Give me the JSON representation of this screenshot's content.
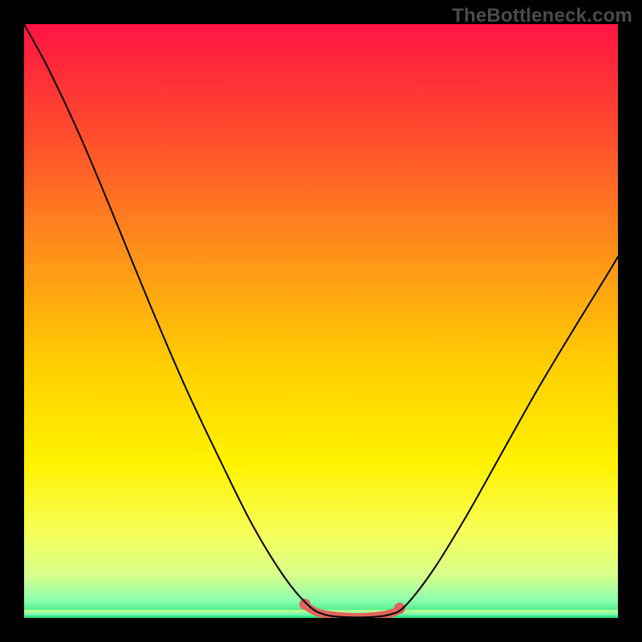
{
  "watermark": "TheBottleneck.com",
  "chart_data": {
    "type": "line",
    "title": "",
    "xlabel": "",
    "ylabel": "",
    "xlim": [
      30,
      770
    ],
    "ylim": [
      30,
      770
    ],
    "grid": false,
    "legend": false,
    "background": {
      "type": "vertical-gradient",
      "stops": [
        {
          "offset": 0.0,
          "color": "#ff1443"
        },
        {
          "offset": 0.18,
          "color": "#ff4a2d"
        },
        {
          "offset": 0.38,
          "color": "#ff8f1a"
        },
        {
          "offset": 0.58,
          "color": "#ffd000"
        },
        {
          "offset": 0.74,
          "color": "#fff200"
        },
        {
          "offset": 0.86,
          "color": "#f6ff5c"
        },
        {
          "offset": 0.93,
          "color": "#d6ff8c"
        },
        {
          "offset": 0.97,
          "color": "#8cffad"
        },
        {
          "offset": 1.0,
          "color": "#28e27a"
        }
      ]
    },
    "series": [
      {
        "name": "curve",
        "color": "#000000",
        "width": 2.0,
        "points": [
          {
            "x": 30,
            "y": 30
          },
          {
            "x": 60,
            "y": 85
          },
          {
            "x": 100,
            "y": 170
          },
          {
            "x": 140,
            "y": 265
          },
          {
            "x": 185,
            "y": 375
          },
          {
            "x": 230,
            "y": 480
          },
          {
            "x": 275,
            "y": 575
          },
          {
            "x": 315,
            "y": 655
          },
          {
            "x": 355,
            "y": 720
          },
          {
            "x": 385,
            "y": 755
          },
          {
            "x": 405,
            "y": 766
          },
          {
            "x": 430,
            "y": 769
          },
          {
            "x": 460,
            "y": 769
          },
          {
            "x": 485,
            "y": 766
          },
          {
            "x": 505,
            "y": 755
          },
          {
            "x": 540,
            "y": 710
          },
          {
            "x": 580,
            "y": 645
          },
          {
            "x": 625,
            "y": 565
          },
          {
            "x": 670,
            "y": 485
          },
          {
            "x": 715,
            "y": 410
          },
          {
            "x": 755,
            "y": 345
          },
          {
            "x": 770,
            "y": 320
          }
        ]
      },
      {
        "name": "highlight",
        "color": "#e0645a",
        "width": 10,
        "points": [
          {
            "x": 378,
            "y": 753
          },
          {
            "x": 395,
            "y": 763
          },
          {
            "x": 415,
            "y": 767
          },
          {
            "x": 440,
            "y": 769
          },
          {
            "x": 465,
            "y": 768
          },
          {
            "x": 485,
            "y": 765
          },
          {
            "x": 498,
            "y": 760
          }
        ],
        "endcaps": [
          {
            "x": 380,
            "y": 753,
            "r": 7.0
          },
          {
            "x": 498,
            "y": 758,
            "r": 7.0
          }
        ]
      }
    ],
    "bottom_bands": [
      {
        "y": 760,
        "h": 3.0,
        "color": "#b6ff93"
      },
      {
        "y": 763,
        "h": 2.5,
        "color": "#8cffad"
      },
      {
        "y": 765.5,
        "h": 2.2,
        "color": "#5cf59e"
      },
      {
        "y": 767.7,
        "h": 2.3,
        "color": "#28e27a"
      }
    ]
  }
}
